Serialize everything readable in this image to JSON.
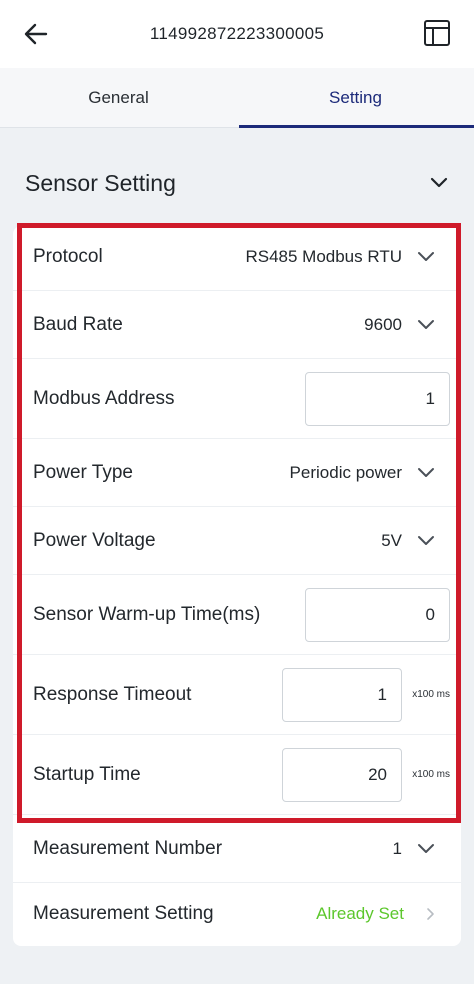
{
  "appbar": {
    "title": "114992872223300005",
    "back_icon": "arrow-left-icon",
    "layout_icon": "layout-panel-icon"
  },
  "tabs": [
    {
      "label": "General",
      "active": false
    },
    {
      "label": "Setting",
      "active": true
    }
  ],
  "section": {
    "title": "Sensor Setting",
    "expanded": true
  },
  "rows": {
    "protocol": {
      "label": "Protocol",
      "value": "RS485 Modbus RTU"
    },
    "baud_rate": {
      "label": "Baud Rate",
      "value": "9600"
    },
    "modbus_address": {
      "label": "Modbus Address",
      "value": "1"
    },
    "power_type": {
      "label": "Power Type",
      "value": "Periodic power"
    },
    "power_voltage": {
      "label": "Power Voltage",
      "value": "5V"
    },
    "warmup_time": {
      "label": "Sensor Warm-up Time(ms)",
      "value": "0"
    },
    "response_timeout": {
      "label": "Response Timeout",
      "value": "1",
      "unit": "x100 ms"
    },
    "startup_time": {
      "label": "Startup Time",
      "value": "20",
      "unit": "x100 ms"
    },
    "measurement_number": {
      "label": "Measurement Number",
      "value": "1"
    },
    "measurement_setting": {
      "label": "Measurement Setting",
      "status": "Already Set"
    }
  },
  "colors": {
    "accent": "#1c2a7a",
    "highlight": "#cf1a2a",
    "status_ok": "#5cc72c",
    "background": "#eef1f4"
  }
}
